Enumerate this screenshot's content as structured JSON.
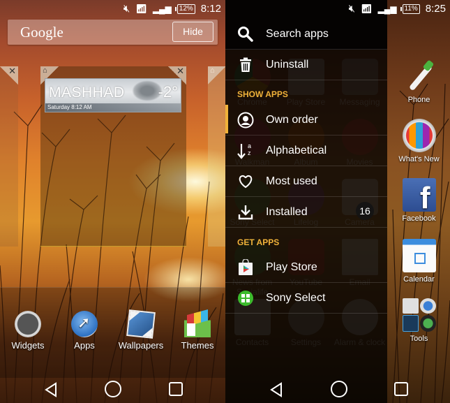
{
  "left_screen": {
    "status_bar": {
      "muted": true,
      "wifi": true,
      "signal": true,
      "battery": "12%",
      "time": "8:12"
    },
    "google_bar": {
      "logo": "Google",
      "hide_label": "Hide"
    },
    "weather_widget": {
      "city": "MASHHAD",
      "temperature": "-2°",
      "date_time": "Saturday 8:12 AM"
    },
    "pane_icons": {
      "home": "home-icon",
      "close": "close-icon"
    },
    "dock": [
      {
        "label": "Widgets",
        "icon": "widgets-icon"
      },
      {
        "label": "Apps",
        "icon": "apps-icon"
      },
      {
        "label": "Wallpapers",
        "icon": "wallpapers-icon"
      },
      {
        "label": "Themes",
        "icon": "themes-icon"
      }
    ]
  },
  "right_screen": {
    "status_bar": {
      "muted": true,
      "wifi": true,
      "signal": true,
      "battery": "11%",
      "time": "8:25"
    },
    "menu": {
      "actions": [
        {
          "label": "Search apps",
          "icon": "search-icon"
        },
        {
          "label": "Uninstall",
          "icon": "trash-icon"
        }
      ],
      "show_apps_header": "SHOW APPS",
      "show_apps": [
        {
          "label": "Own order",
          "icon": "person-icon",
          "selected": true
        },
        {
          "label": "Alphabetical",
          "icon": "sort-az-icon",
          "selected": false
        },
        {
          "label": "Most used",
          "icon": "heart-icon",
          "selected": false
        },
        {
          "label": "Installed",
          "icon": "download-icon",
          "selected": false
        }
      ],
      "get_apps_header": "GET APPS",
      "get_apps": [
        {
          "label": "Play Store",
          "icon": "play-store-icon"
        },
        {
          "label": "Sony Select",
          "icon": "sony-select-icon"
        }
      ]
    },
    "background_apps": [
      {
        "label": "Chrome"
      },
      {
        "label": "Play Store"
      },
      {
        "label": "Messaging"
      },
      {
        "label": "Walkman"
      },
      {
        "label": "Album"
      },
      {
        "label": "Movies"
      },
      {
        "label": "Sony Select"
      },
      {
        "label": "Lifelog"
      },
      {
        "label": "Camera"
      },
      {
        "label": "News from Socialife"
      },
      {
        "label": "YouTube"
      },
      {
        "label": "Email"
      },
      {
        "label": "Contacts"
      },
      {
        "label": "Settings"
      },
      {
        "label": "Alarm & clock"
      }
    ],
    "camera_badge": "16",
    "side_apps": [
      {
        "label": "Phone"
      },
      {
        "label": "What's New"
      },
      {
        "label": "Facebook"
      },
      {
        "label": "Calendar"
      },
      {
        "label": "Tools"
      }
    ]
  },
  "colors": {
    "accent": "#f0b23a"
  }
}
